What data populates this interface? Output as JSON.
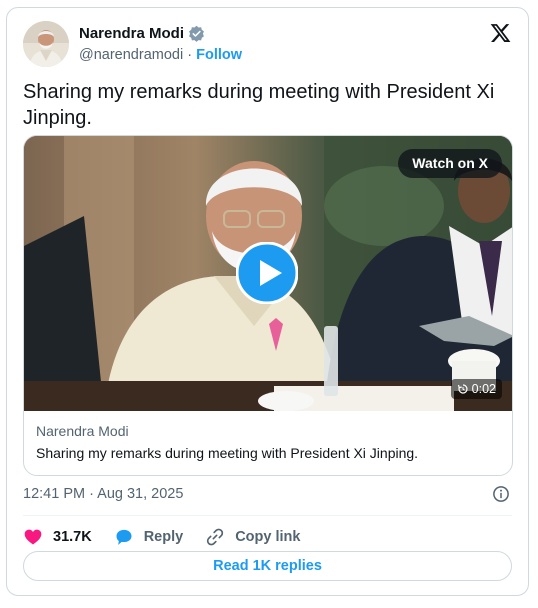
{
  "author": {
    "name": "Narendra Modi",
    "handle": "@narendramodi",
    "separator": "·",
    "follow_label": "Follow"
  },
  "tweet": {
    "text": "Sharing my remarks during meeting with President Xi Jinping."
  },
  "media": {
    "watch_label": "Watch on X",
    "duration": "0:02",
    "card_title": "Narendra Modi",
    "card_text": "Sharing my remarks during meeting with President Xi Jinping."
  },
  "meta": {
    "timestamp": "12:41 PM · Aug 31, 2025"
  },
  "actions": {
    "likes": "31.7K",
    "reply_label": "Reply",
    "copy_link_label": "Copy link"
  },
  "read_replies_label": "Read 1K replies",
  "colors": {
    "accent": "#1d9bf0",
    "like": "#f91880",
    "text_primary": "#0f1419",
    "text_secondary": "#536471",
    "border": "#cfd9de"
  },
  "icons": [
    "verified-badge-icon",
    "x-logo-icon",
    "play-icon",
    "replay-icon",
    "info-icon",
    "heart-icon",
    "reply-bubble-icon",
    "link-icon"
  ]
}
